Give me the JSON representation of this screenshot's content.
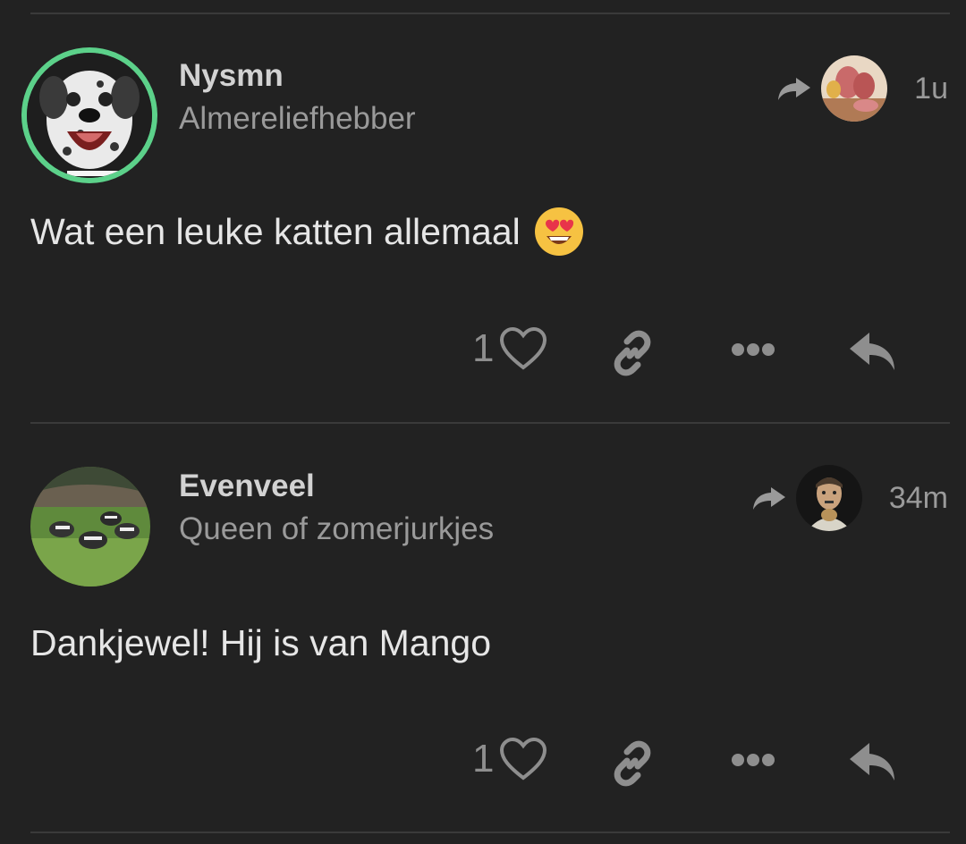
{
  "posts": [
    {
      "author": "Nysmn",
      "user_title": "Almereliefhebber",
      "timestamp": "1u",
      "text": "Wat een leuke katten allemaal",
      "emoji": "heart-eyes-emoji",
      "like_count": "1",
      "avatar": "dalmatian-dog-avatar",
      "reply_avatar": "sausage-avatar"
    },
    {
      "author": "Evenveel",
      "user_title": "Queen of zomerjurkjes",
      "timestamp": "34m",
      "text": "Dankjewel! Hij is van Mango",
      "like_count": "1",
      "avatar": "badgers-avatar",
      "reply_avatar": "man-portrait-avatar"
    }
  ],
  "icons": {
    "reply_to": "share-arrow-icon",
    "like": "heart-outline-icon",
    "link": "link-icon",
    "more": "more-dots-icon",
    "reply": "reply-icon"
  },
  "colors": {
    "background": "#222222",
    "online_ring": "#5cd18a",
    "muted": "#8e8e8e"
  }
}
